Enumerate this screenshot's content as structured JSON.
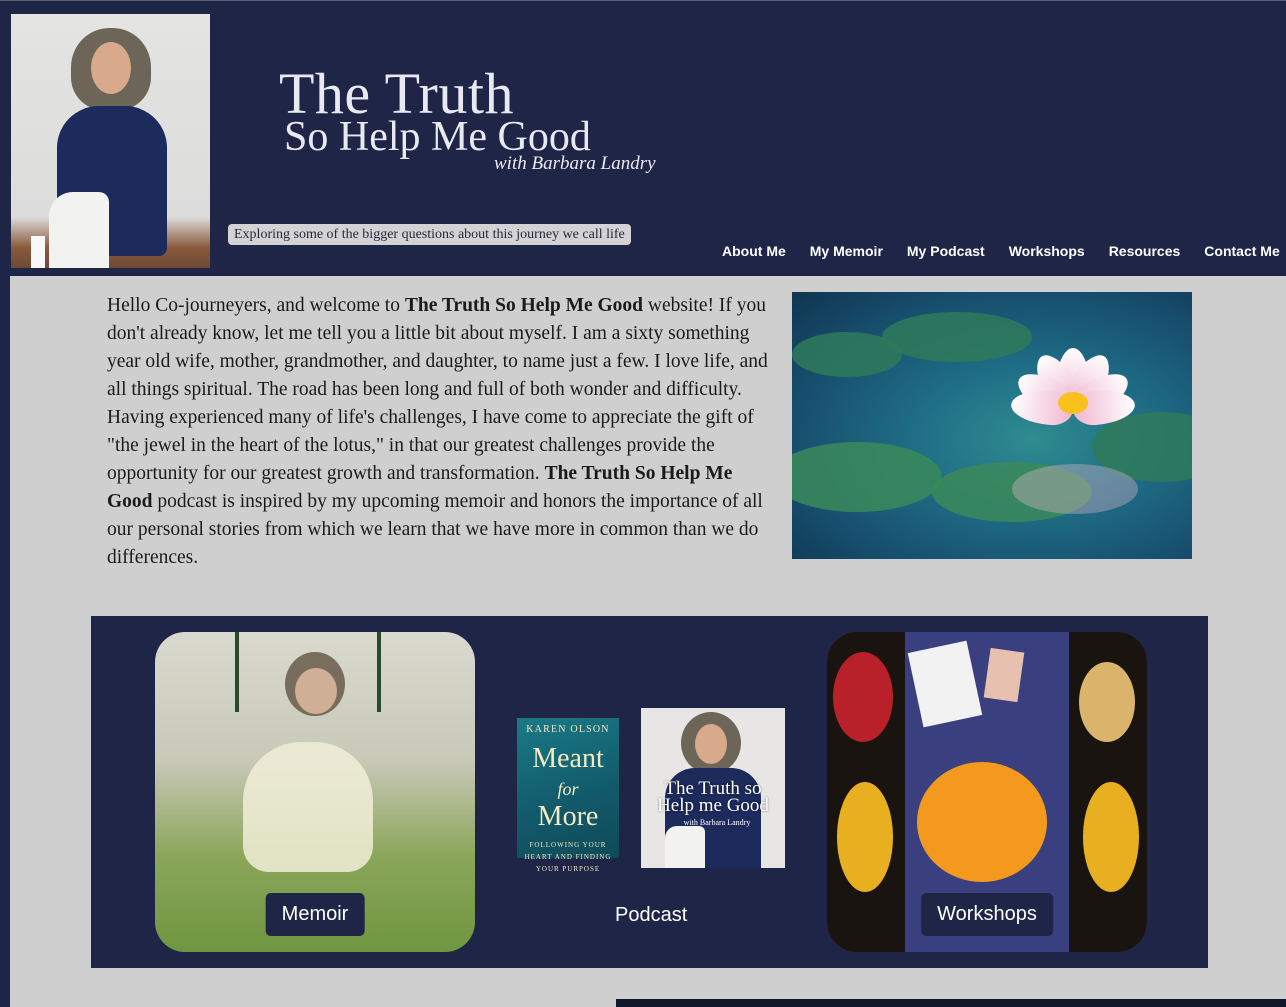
{
  "header": {
    "title": "The Truth",
    "subtitle": "So Help Me Good",
    "byline": "with Barbara Landry",
    "tagline": "Exploring some of the bigger questions about this journey we call life"
  },
  "nav": {
    "items": [
      {
        "label": "About Me"
      },
      {
        "label": "My Memoir"
      },
      {
        "label": "My Podcast"
      },
      {
        "label": "Workshops"
      },
      {
        "label": "Resources"
      },
      {
        "label": "Contact Me"
      }
    ]
  },
  "intro": {
    "text_1": "Hello Co-journeyers, and welcome to ",
    "bold_1": "The Truth So Help Me Good",
    "text_2": " website! If you don't already know, let me tell you a little bit about myself. I am a sixty something year old wife, mother, grandmother, and daughter, to name just a few. I love life, and all things spiritual. The road has been long and full of both wonder and difficulty. Having experienced many of life's challenges, I have come to appreciate the gift of \"the jewel in the heart of the lotus,\" in that our greatest challenges provide the opportunity for our greatest growth and transformation. ",
    "bold_2": "The Truth So Help Me Good",
    "text_3": " podcast is inspired by my upcoming memoir and honors the importance of all our personal stories from which we learn that we have more in common than we do differences."
  },
  "features": {
    "memoir_label": "Memoir",
    "podcast_label": "Podcast",
    "workshops_label": "Workshops",
    "book": {
      "author": "KAREN OLSON",
      "title_1": "Meant",
      "title_2": "for",
      "title_3": "More",
      "subtitle": "FOLLOWING YOUR HEART AND FINDING YOUR PURPOSE"
    },
    "podcast_cover": {
      "title": "The Truth so Help me Good",
      "byline": "with Barbara Landry"
    }
  },
  "colors": {
    "navy": "#1e2547",
    "content_bg": "#cfcfd0",
    "text": "#1a1a1a"
  }
}
